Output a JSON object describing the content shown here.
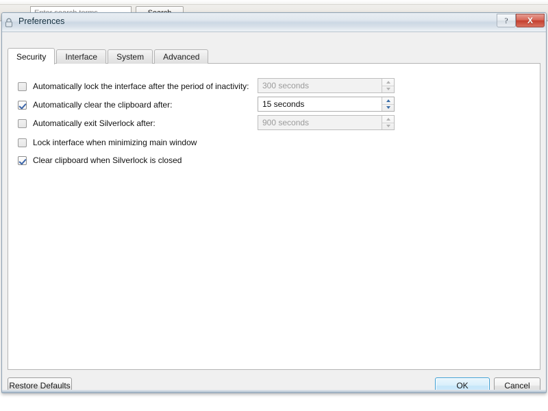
{
  "background_app": {
    "search_input_placeholder": "Enter search terms",
    "search_button_label": "Search",
    "nav_icon": "back-arrow-icon"
  },
  "dialog": {
    "title": "Preferences",
    "title_icon": "padlock-icon",
    "window_buttons": {
      "help_label": "?",
      "help_icon": "help-question-icon",
      "close_label": "X",
      "close_icon": "close-x-icon"
    },
    "tabs": [
      {
        "label": "Security",
        "active": true
      },
      {
        "label": "Interface",
        "active": false
      },
      {
        "label": "System",
        "active": false
      },
      {
        "label": "Advanced",
        "active": false
      }
    ],
    "security_tab": {
      "options": [
        {
          "label": "Automatically lock the interface after the period of inactivity:",
          "checked": false,
          "has_spinner": true,
          "spinner_value": "300 seconds",
          "spinner_enabled": false
        },
        {
          "label": "Automatically clear the clipboard after:",
          "checked": true,
          "has_spinner": true,
          "spinner_value": "15 seconds",
          "spinner_enabled": true
        },
        {
          "label": "Automatically exit Silverlock after:",
          "checked": false,
          "has_spinner": true,
          "spinner_value": "900 seconds",
          "spinner_enabled": false
        },
        {
          "label": "Lock interface when minimizing main window",
          "checked": false,
          "has_spinner": false,
          "spinner_value": "",
          "spinner_enabled": false
        },
        {
          "label": "Clear clipboard when Silverlock is closed",
          "checked": true,
          "has_spinner": false,
          "spinner_value": "",
          "spinner_enabled": false
        }
      ]
    },
    "footer": {
      "restore_defaults_label": "Restore Defaults",
      "ok_label": "OK",
      "cancel_label": "Cancel"
    }
  },
  "colors": {
    "accent_blue": "#3c9fd4",
    "checkmark_blue": "#3c65a8",
    "close_red": "#c4402f",
    "titlebar_blue": "#ccd8e4"
  }
}
